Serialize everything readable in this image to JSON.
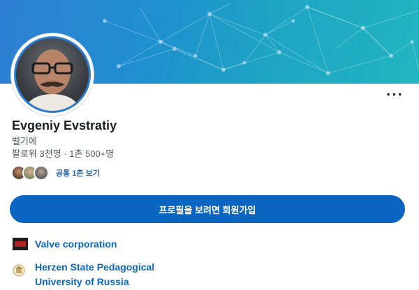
{
  "profile": {
    "name": "Evgeniy Evstratiy",
    "subtitle": "벨기에",
    "followers": "팔로워 3천명 · 1촌 500+명",
    "mutual_text": "공통 1촌 보기",
    "join_button": "프로필을 보려면 회원가입",
    "more_icon": "more-dots-icon"
  },
  "organizations": [
    {
      "name": "Valve corporation",
      "icon": "valve-logo-icon"
    },
    {
      "name_line1": "Herzen State Pedagogical",
      "name_line2": "University of Russia",
      "icon": "herzen-logo-icon"
    }
  ],
  "colors": {
    "accent": "#0b66c2",
    "link": "#0a66c2",
    "banner_start": "#2f7fd4",
    "banner_end": "#22b5c0"
  }
}
